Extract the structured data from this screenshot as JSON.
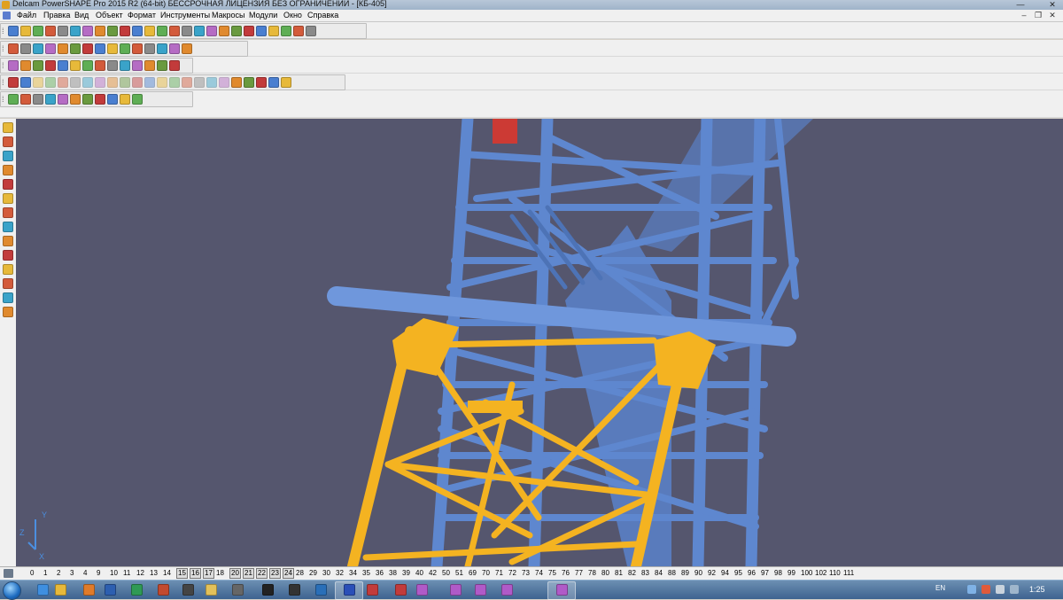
{
  "window": {
    "title": "Delcam PowerSHAPE Pro 2015 R2 (64-bit) БЕССРОЧНАЯ ЛИЦЕНЗИЯ БЕЗ ОГРАНИЧЕНИЙ - [КБ-405]",
    "minimize_label": "—",
    "close_label": "✕",
    "mdi_minimize_label": "–",
    "mdi_restore_label": "❐",
    "mdi_close_label": "✕"
  },
  "menu": {
    "items": [
      "Файл",
      "Правка",
      "Вид",
      "Объект",
      "Формат",
      "Инструменты",
      "Макросы",
      "Модули",
      "Окно",
      "Справка"
    ]
  },
  "toolbars": {
    "grip_label": "⁞",
    "rows": [
      {
        "name": "main",
        "icons": [
          "new-icon",
          "open-icon",
          "open-folder-icon",
          "save-icon",
          "print-icon",
          "print-preview-icon",
          "cut-icon",
          "copy-icon",
          "paste-icon",
          "delete-icon",
          "erase-icon",
          "undo-icon",
          "redo-icon",
          "measure-icon",
          "select-icon",
          "workplane-icon",
          "line-icon",
          "circle-icon",
          "arc-icon",
          "text-icon",
          "dimension-icon",
          "surface-icon",
          "solid-icon",
          "assembly-icon",
          "wizard-icon"
        ]
      },
      {
        "name": "view",
        "icons": [
          "box-view-icon",
          "iso-view-icon",
          "shaded-icon",
          "shaded-wire-icon",
          "wireframe-icon",
          "zoom-icon",
          "zoom-box-icon",
          "zoom-in-icon",
          "zoom-out-icon",
          "zoom-all-icon",
          "globe-icon",
          "shade-icon",
          "material-icon",
          "light-icon",
          "hand-icon"
        ]
      },
      {
        "name": "object",
        "icons": [
          "layer-icon",
          "doc-icon",
          "model-icon",
          "sphere-green-icon",
          "sphere-red-icon",
          "triangle-icon",
          "arrow-icon",
          "block-icon",
          "cube-icon",
          "group-icon",
          "filter-icon",
          "move-icon",
          "rotate-icon",
          "mirror-icon"
        ]
      },
      {
        "name": "solid",
        "icons": [
          "solid-box-icon",
          "extrude-icon",
          "revolve-icon",
          "sweep-icon",
          "boolean-icon",
          "fillet-icon",
          "chamfer-icon",
          "shell-icon",
          "cut-solid-icon",
          "draft-icon",
          "offset-icon",
          "split-icon",
          "feature-icon",
          "tree-icon",
          "copy-solid-icon",
          "scale-icon",
          "array-icon",
          "remove-icon",
          "replace-icon",
          "attach-icon",
          "detach-icon",
          "history-icon",
          "settings-icon"
        ]
      },
      {
        "name": "analysis",
        "icons": [
          "analysis-icon",
          "section-icon",
          "curve-icon",
          "distance-icon",
          "clearance-icon",
          "volume-icon",
          "mass-icon",
          "gear-icon",
          "chain-icon",
          "paint-icon",
          "render-icon"
        ]
      }
    ]
  },
  "left_tools": {
    "icons": [
      "pointer-icon",
      "select-box-icon",
      "line-tool-icon",
      "warning-icon",
      "curve-tool-icon",
      "surface-tool-icon",
      "solid-tool-icon",
      "dim-tool-icon",
      "mesh-tool-icon",
      "symbol-tool-icon",
      "color-icon",
      "shade-tool-icon",
      "cube-tool-icon",
      "assembly-tool-icon"
    ]
  },
  "viewport": {
    "background": "#55566e",
    "structure_blue": "#5e87cf",
    "structure_yellow": "#f4b321",
    "axis_color": "#4b8fe0",
    "axis_y_label": "Y",
    "axis_x_label": "X",
    "axis_z_label": "Z"
  },
  "levels": {
    "items": [
      {
        "label": "0",
        "boxed": false
      },
      {
        "label": "1",
        "boxed": false
      },
      {
        "label": "2",
        "boxed": false
      },
      {
        "label": "3",
        "boxed": false
      },
      {
        "label": "4",
        "boxed": false
      },
      {
        "label": "9",
        "boxed": false
      },
      {
        "label": "10",
        "boxed": false
      },
      {
        "label": "11",
        "boxed": false
      },
      {
        "label": "12",
        "boxed": false
      },
      {
        "label": "13",
        "boxed": false
      },
      {
        "label": "14",
        "boxed": false
      },
      {
        "label": "15",
        "boxed": true
      },
      {
        "label": "16",
        "boxed": true
      },
      {
        "label": "17",
        "boxed": true
      },
      {
        "label": "18",
        "boxed": false
      },
      {
        "label": "20",
        "boxed": true
      },
      {
        "label": "21",
        "boxed": true
      },
      {
        "label": "22",
        "boxed": true
      },
      {
        "label": "23",
        "boxed": true
      },
      {
        "label": "24",
        "boxed": true
      },
      {
        "label": "28",
        "boxed": false
      },
      {
        "label": "29",
        "boxed": false
      },
      {
        "label": "30",
        "boxed": false
      },
      {
        "label": "32",
        "boxed": false
      },
      {
        "label": "34",
        "boxed": false
      },
      {
        "label": "35",
        "boxed": false
      },
      {
        "label": "36",
        "boxed": false
      },
      {
        "label": "38",
        "boxed": false
      },
      {
        "label": "39",
        "boxed": false
      },
      {
        "label": "40",
        "boxed": false
      },
      {
        "label": "42",
        "boxed": false
      },
      {
        "label": "50",
        "boxed": false
      },
      {
        "label": "51",
        "boxed": false
      },
      {
        "label": "69",
        "boxed": false
      },
      {
        "label": "70",
        "boxed": false
      },
      {
        "label": "71",
        "boxed": false
      },
      {
        "label": "72",
        "boxed": false
      },
      {
        "label": "73",
        "boxed": false
      },
      {
        "label": "74",
        "boxed": false
      },
      {
        "label": "75",
        "boxed": false
      },
      {
        "label": "76",
        "boxed": false
      },
      {
        "label": "77",
        "boxed": false
      },
      {
        "label": "78",
        "boxed": false
      },
      {
        "label": "80",
        "boxed": false
      },
      {
        "label": "81",
        "boxed": false
      },
      {
        "label": "82",
        "boxed": false
      },
      {
        "label": "83",
        "boxed": false
      },
      {
        "label": "84",
        "boxed": false
      },
      {
        "label": "88",
        "boxed": false
      },
      {
        "label": "89",
        "boxed": false
      },
      {
        "label": "90",
        "boxed": false
      },
      {
        "label": "92",
        "boxed": false
      },
      {
        "label": "94",
        "boxed": false
      },
      {
        "label": "95",
        "boxed": false
      },
      {
        "label": "96",
        "boxed": false
      },
      {
        "label": "97",
        "boxed": false
      },
      {
        "label": "98",
        "boxed": false
      },
      {
        "label": "99",
        "boxed": false
      },
      {
        "label": "100",
        "boxed": false
      },
      {
        "label": "102",
        "boxed": false
      },
      {
        "label": "110",
        "boxed": false
      },
      {
        "label": "111",
        "boxed": false
      }
    ]
  },
  "taskbar": {
    "apps": [
      "ie-icon",
      "explorer-icon",
      "firefox-icon",
      "word-icon",
      "excel-icon",
      "powerpoint-icon",
      "media-icon",
      "folder-icon",
      "app-icon",
      "unity-icon",
      "terminal-icon",
      "photoshop-icon",
      "save-app-icon",
      "video-icon",
      "autocad-icon",
      "powershape-icon",
      "powershape-icon-2",
      "powershape-icon-3",
      "powershape-icon-4",
      "powershape-active-icon"
    ],
    "language": "EN",
    "clock": "1:25"
  }
}
